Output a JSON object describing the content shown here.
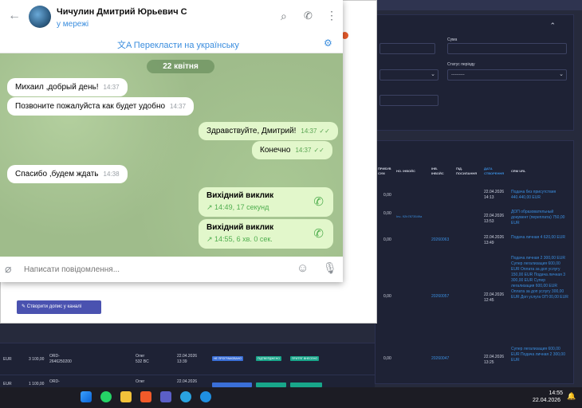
{
  "header": {
    "name": "Чичулин Дмитрий Юрьевич С",
    "status": "у мережі"
  },
  "translate": {
    "label": "Перекласти на українську"
  },
  "chat": {
    "date": "22 квітня",
    "messages": [
      {
        "text": "Михаил ,добрый день!",
        "time": "14:37"
      },
      {
        "text": "Позвоните пожалуйста как будет удобно",
        "time": "14:37"
      },
      {
        "text": "Здравствуйте, Дмитрий!",
        "time": "14:37"
      },
      {
        "text": "Конечно",
        "time": "14:37"
      },
      {
        "text": "Спасибо ,будем ждать",
        "time": "14:38"
      }
    ],
    "calls": [
      {
        "title": "Вихідний виклик",
        "sub": "14:49, 17 секунд"
      },
      {
        "title": "Вихідний виклик",
        "sub": "14:55, 6 хв. 0 сек."
      }
    ]
  },
  "compose": {
    "placeholder": "Написати повідомлення..."
  },
  "channel_button": "Створити допис у каналі",
  "form": {
    "sum_label": "Сума",
    "status_label": "Статус періоду",
    "status_value": "----------"
  },
  "table": {
    "headers": [
      "ПРИБУВ СУМ",
      "НО. ІНВОЙС",
      "ІНВ. ІНВОЙС",
      "ПІД. ПОСИЛАННЯ",
      "ДАТА СТВОРЕННЯ",
      "CRM URL"
    ],
    "rows": [
      {
        "amount": "0,00",
        "inv": "",
        "inv2": "",
        "date": "22.04.2026",
        "time": "14:13",
        "crm": "Подача без присутствия 440.440,00 EUR"
      },
      {
        "amount": "0,00",
        "inv": "Inv- 92b7873549a",
        "inv2": "",
        "date": "22.04.2026",
        "time": "13:53",
        "crm": "ДОП образовательный документ (переплата) 750,00 EUR"
      },
      {
        "amount": "0,00",
        "inv": "",
        "inv2": "20260063",
        "date": "22.04.2026",
        "time": "13:49",
        "crm": "Подача личная 4 620,00 EUR"
      },
      {
        "amount": "0,00",
        "inv": "",
        "inv2": "20260057",
        "date": "22.04.2026",
        "time": "12:45",
        "crm": "Подача личная 2 300,00 EUR Супер легализация 600,00 EUR Оплата за доп услугу 150,00 EUR Подача личная 3 300,00 EUR Супер легализация 600,00 EUR Оплата за доп услугу 300,00 EUR Доп услуга ОП 00,00 EUR"
      },
      {
        "amount": "0,00",
        "inv": "",
        "inv2": "20260047",
        "date": "22.04.2026",
        "time": "13:25",
        "crm": "Супер легализация 600,00 EUR Подача личная 2 300,00 EUR"
      }
    ]
  },
  "bottom_rows": [
    {
      "cur": "EUR",
      "amount": "3 100,00",
      "ord": "ORD- 2646250200",
      "agent": "Олег",
      "code": "532 BC",
      "date": "22.04.2026",
      "time": "13:39",
      "tags": [
        "НЕ ПРОГРАМОВАНО",
        "ПІДТВЕРДЖЕНО",
        "ПРИТЯГ ВНЕСЕНО"
      ]
    },
    {
      "cur": "EUR",
      "amount": "1 100,00",
      "ord": "ORD-",
      "agent": "Олег",
      "code": "",
      "date": "22.04.2026",
      "time": "",
      "tags": []
    }
  ],
  "taskbar": {
    "time": "14:55",
    "date": "22.04.2026"
  },
  "colors": {
    "accent": "#3a8dde",
    "chat_bg": "#9fbc8b",
    "out_bubble": "#e2f7cb",
    "green": "#4fae4e"
  }
}
